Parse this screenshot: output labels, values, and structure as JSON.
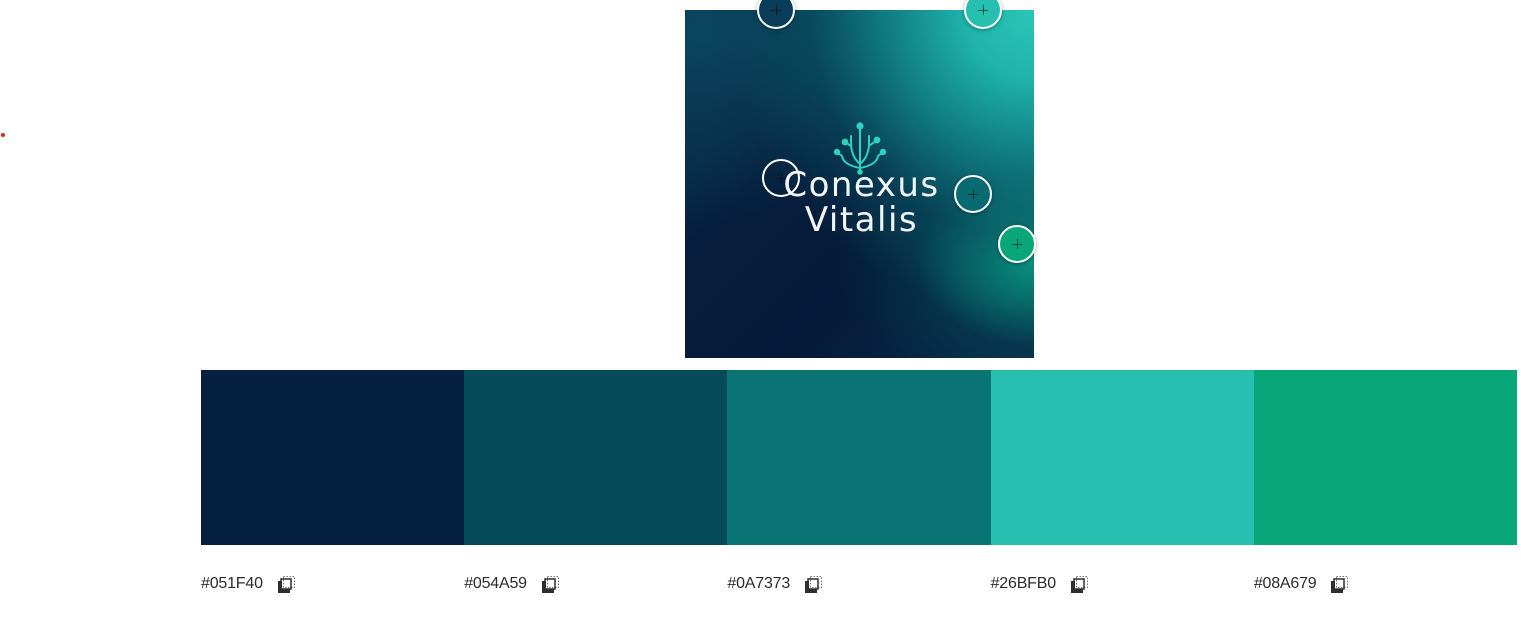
{
  "image": {
    "brand_line_1": "Conexus",
    "brand_line_2": "Vitalis",
    "logo_icon": "network-tree-logo",
    "logo_color": "#2fd3bd"
  },
  "pickers": [
    {
      "icon": "color-picker-handle",
      "color": "#0a3d58"
    },
    {
      "icon": "color-picker-handle",
      "color": "#26bfb0"
    },
    {
      "icon": "color-picker-handle",
      "color": "#061e3d"
    },
    {
      "icon": "color-picker-handle",
      "color": "#0a6a72"
    },
    {
      "icon": "color-picker-handle",
      "color": "#08a679"
    }
  ],
  "palette": {
    "swatches": [
      {
        "hex": "#051F40",
        "color": "#051f40"
      },
      {
        "hex": "#054A59",
        "color": "#054a59"
      },
      {
        "hex": "#0A7373",
        "color": "#0a7373"
      },
      {
        "hex": "#26BFB0",
        "color": "#26bfb0"
      },
      {
        "hex": "#08A679",
        "color": "#08a679"
      }
    ],
    "copy_icon": "copy-icon"
  }
}
